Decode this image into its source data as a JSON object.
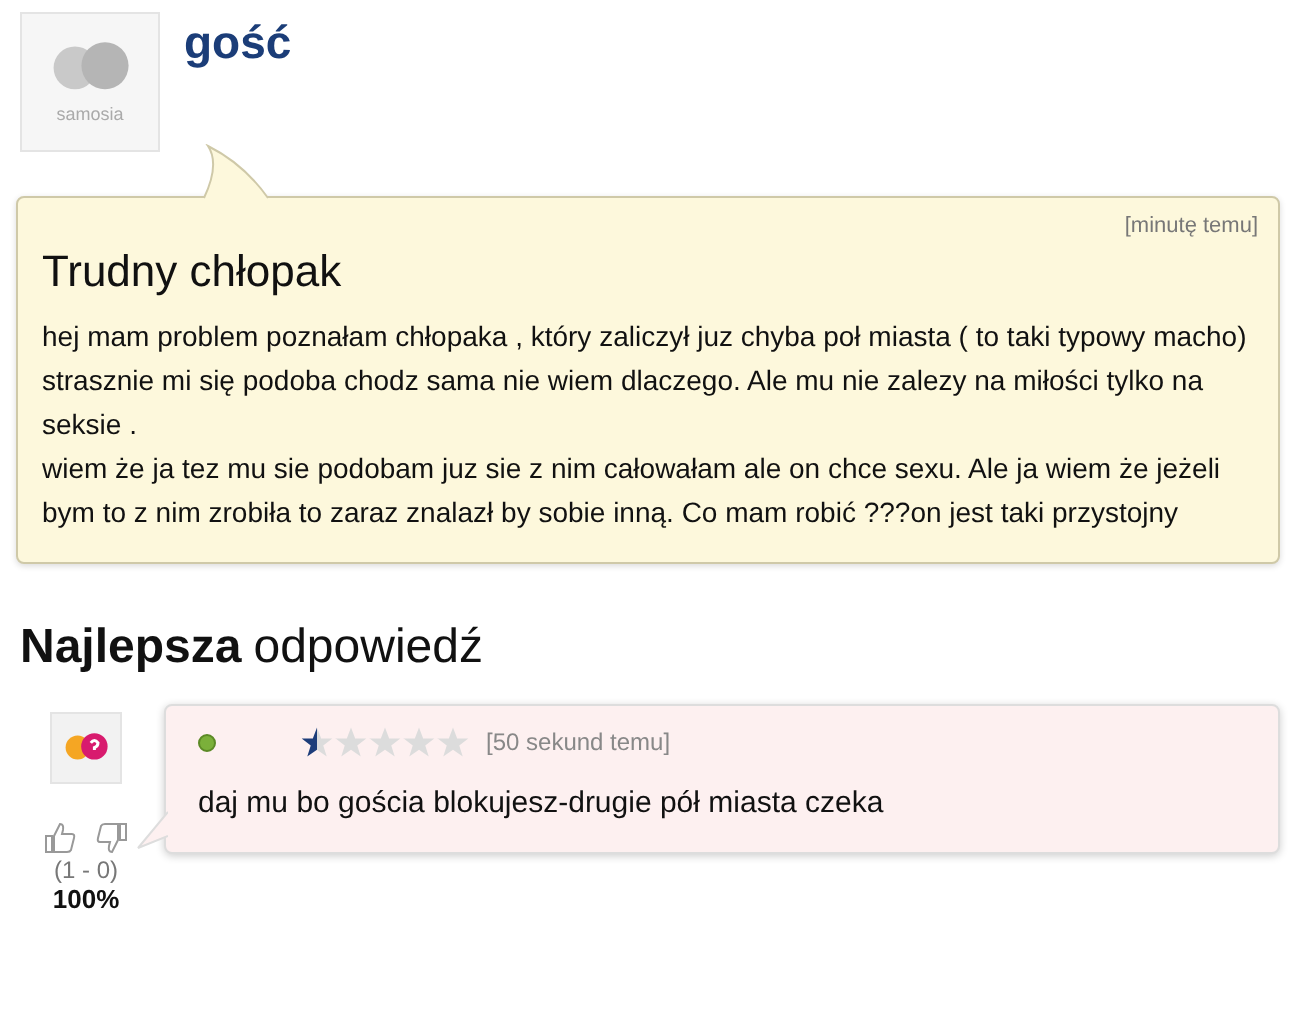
{
  "question": {
    "author": "gość",
    "avatar_label": "samosia",
    "time": "[minutę temu]",
    "title": "Trudny chłopak",
    "paragraphs": [
      "hej mam problem poznałam chłopaka , który zaliczył juz chyba poł miasta ( to taki typowy macho) strasznie mi się podoba chodz sama nie wiem dlaczego. Ale mu nie zalezy na miłości tylko na seksie .",
      "wiem że ja tez mu sie podobam juz sie z nim całowałam ale on chce sexu. Ale ja wiem że jeżeli bym to z nim zrobiła to zaraz znalazł by sobie inną. Co mam robić ???on jest taki przystojny"
    ]
  },
  "best_answer": {
    "heading_bold": "Najlepsza",
    "heading_rest": "odpowiedź",
    "online": true,
    "stars": 0.5,
    "time": "[50 sekund temu]",
    "text": "daj mu bo gościa blokujesz-drugie pół miasta czeka",
    "votes": "(1 - 0)",
    "percent": "100%"
  }
}
